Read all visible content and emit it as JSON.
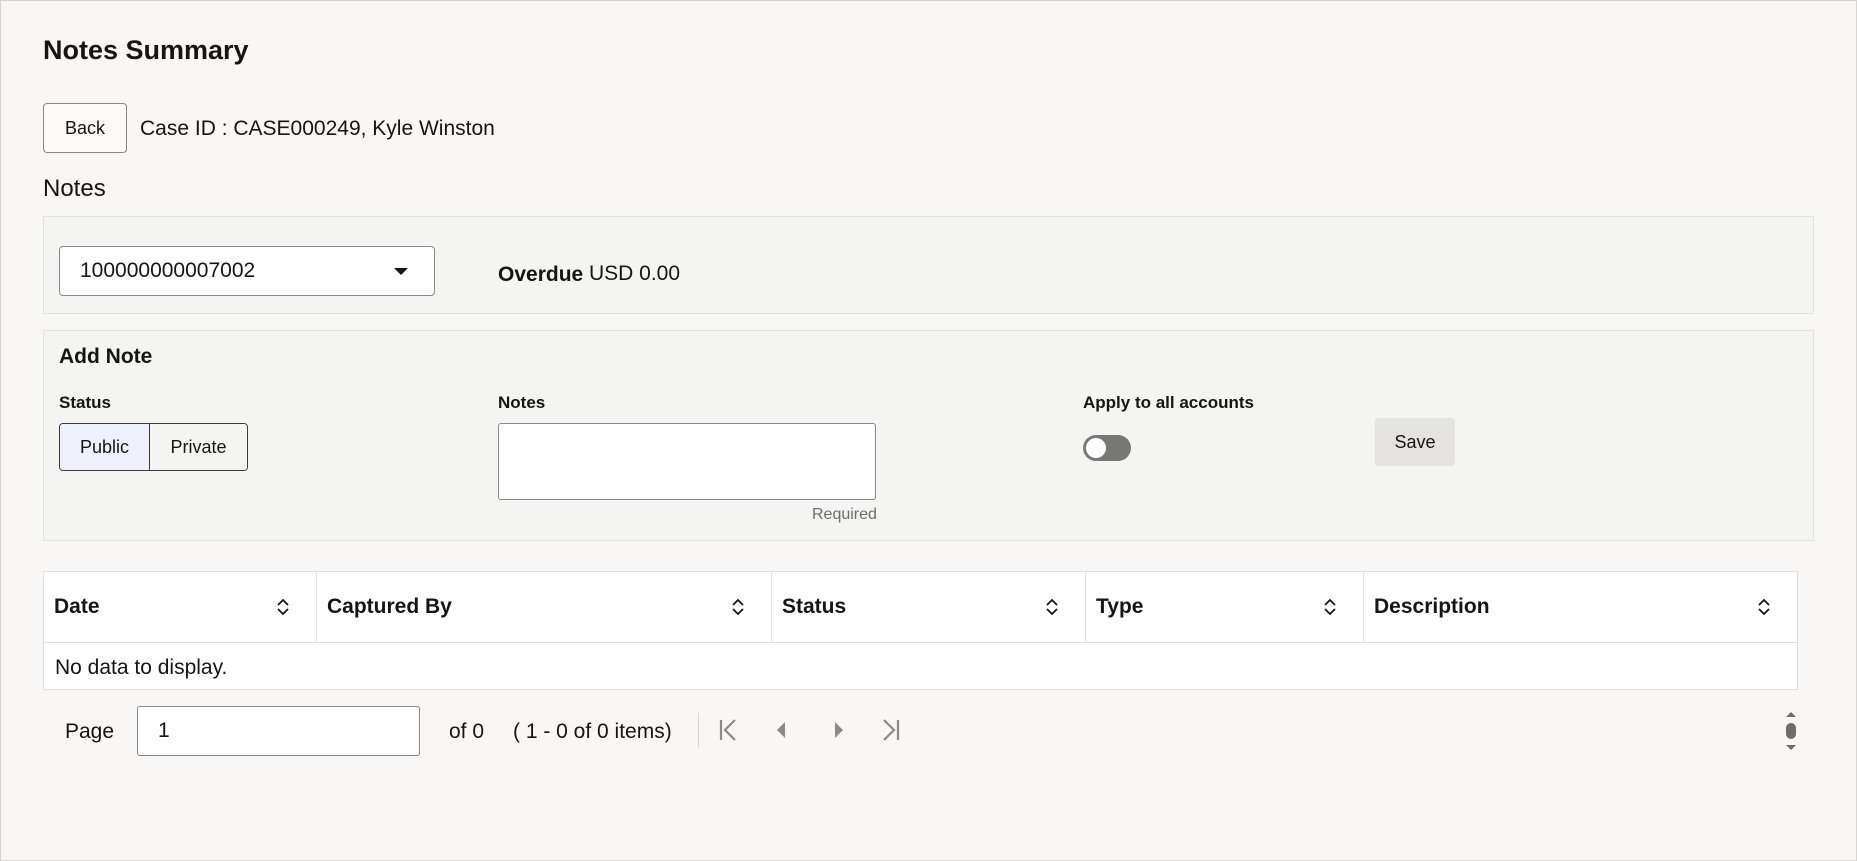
{
  "page": {
    "title": "Notes Summary",
    "back_label": "Back",
    "case_line": "Case ID : CASE000249,  Kyle Winston",
    "notes_heading": "Notes"
  },
  "account": {
    "selected": "100000000007002",
    "overdue_label": "Overdue",
    "overdue_value": "USD 0.00"
  },
  "add_note": {
    "title": "Add Note",
    "status_label": "Status",
    "status_options": [
      "Public",
      "Private"
    ],
    "status_selected": "Public",
    "notes_label": "Notes",
    "notes_value": "",
    "notes_helper": "Required",
    "apply_all_label": "Apply to all accounts",
    "apply_all_on": false,
    "save_label": "Save"
  },
  "table": {
    "columns": [
      "Date",
      "Captured By",
      "Status",
      "Type",
      "Description"
    ],
    "empty_text": "No data to display."
  },
  "pager": {
    "page_label": "Page",
    "page_value": "1",
    "of_text": "of 0",
    "items_text": "( 1 - 0 of 0 items)"
  },
  "colors": {
    "background": "#f8f7f5",
    "panel": "#f4f4f3",
    "selected_segment": "#eef1fb",
    "toggle_off": "#7a7876",
    "save_button": "#e4e3e1"
  }
}
